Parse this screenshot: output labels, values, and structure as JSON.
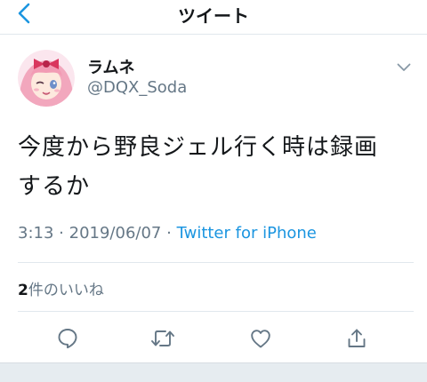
{
  "header": {
    "title": "ツイート",
    "back_icon": "chevron-left-icon"
  },
  "tweet": {
    "author": {
      "display_name": "ラムネ",
      "handle": "@DQX_Soda"
    },
    "text_lines": [
      "今度から野良ジェル行く時は録画",
      "するか"
    ],
    "time": "3:13",
    "date": "2019/06/07",
    "separator": "·",
    "source": "Twitter for iPhone",
    "likes": {
      "count": "2",
      "label": "件のいいね"
    }
  },
  "actions": [
    {
      "name": "reply",
      "icon": "reply-icon"
    },
    {
      "name": "retweet",
      "icon": "retweet-icon"
    },
    {
      "name": "like",
      "icon": "heart-icon"
    },
    {
      "name": "share",
      "icon": "share-icon"
    }
  ],
  "colors": {
    "accent": "#1b95e0",
    "text": "#14171a",
    "secondary_text": "#657786",
    "divider": "#e1e8ed",
    "icon": "#657786"
  }
}
